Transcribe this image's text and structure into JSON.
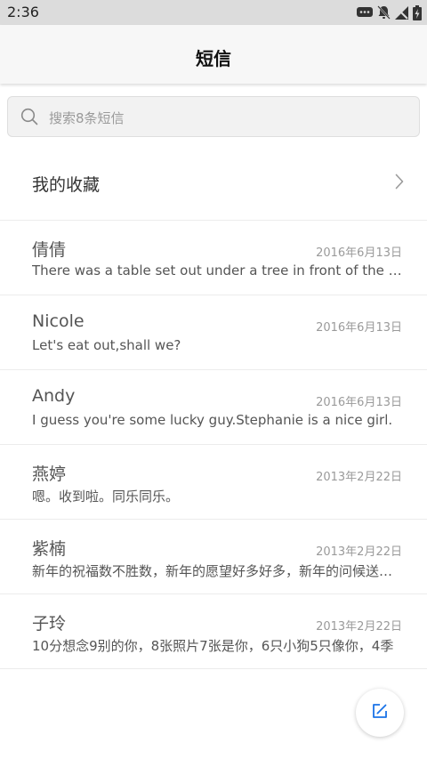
{
  "status_bar": {
    "time": "2:36"
  },
  "header": {
    "title": "短信"
  },
  "search": {
    "placeholder": "搜索8条短信"
  },
  "favorites": {
    "label": "我的收藏"
  },
  "threads": [
    {
      "name": "倩倩",
      "date": "2016年6月13日",
      "preview": "There was a table set out under a tree in front of the house"
    },
    {
      "name": "Nicole",
      "date": "2016年6月13日",
      "preview": "Let's eat out,shall we?"
    },
    {
      "name": "Andy",
      "date": "2016年6月13日",
      "preview": "I guess you're some lucky guy.Stephanie is a nice girl."
    },
    {
      "name": "燕婷",
      "date": "2013年2月22日",
      "preview": "嗯。收到啦。同乐同乐。"
    },
    {
      "name": "紫楠",
      "date": "2013年2月22日",
      "preview": "新年的祝福数不胜数，新年的愿望好多好多，新年的问候送给你"
    },
    {
      "name": "子玲",
      "date": "2013年2月22日",
      "preview": "10分想念9别的你，8张照片7张是你，6只小狗5只像你，4季"
    }
  ],
  "icons": {
    "search": "search-icon",
    "chevron": "chevron-right-icon",
    "compose": "compose-icon",
    "message_status": "message-icon",
    "notifications_off": "bell-off-icon",
    "no_signal": "no-signal-icon",
    "battery": "battery-charging-icon"
  },
  "colors": {
    "accent": "#1a73e8",
    "status_bar": "#dcdcdc",
    "app_bar": "#f7f7f7"
  }
}
